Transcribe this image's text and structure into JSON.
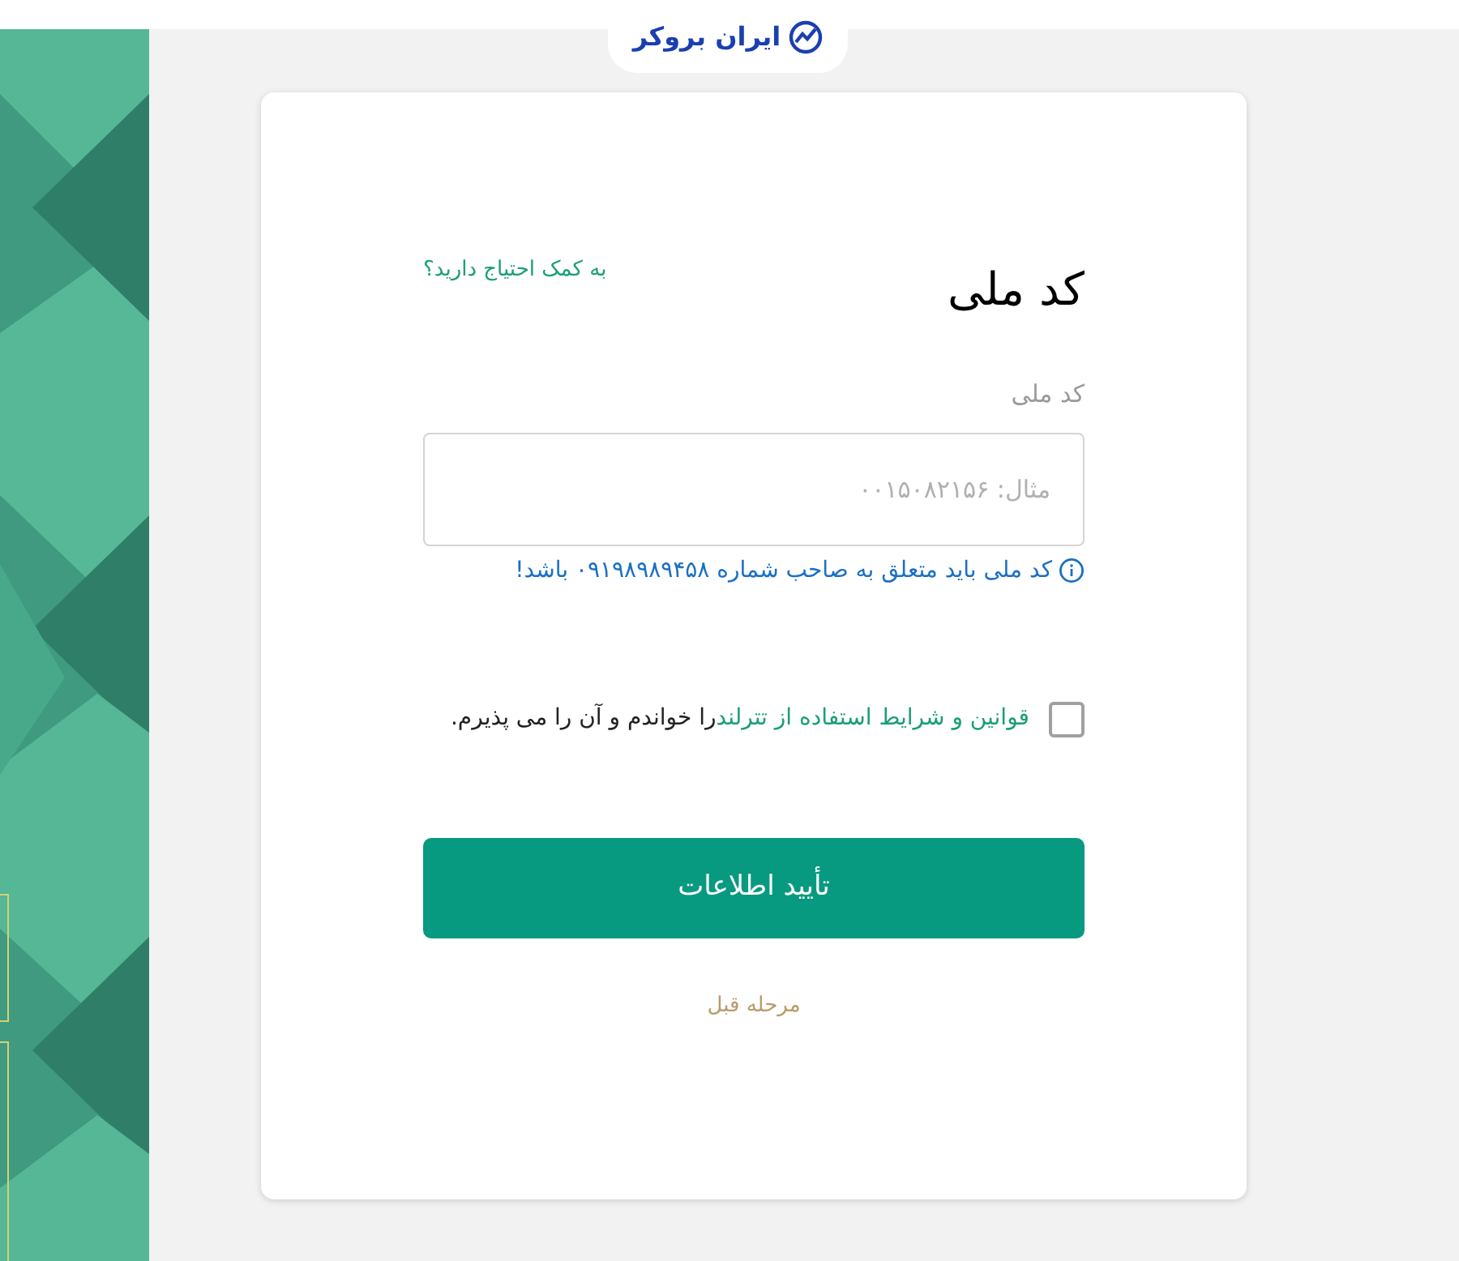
{
  "header": {
    "logo": "ایران بروکر"
  },
  "form": {
    "title": "کد ملی",
    "help_link": "به کمک احتیاج دارید؟",
    "field": {
      "label": "کد ملی",
      "placeholder": "مثال: ۰۰۱۵۰۸۲۱۵۶"
    },
    "hint": "کد ملی باید متعلق به صاحب شماره ۰۹۱۹۸۹۸۹۴۵۸ باشد!",
    "terms": {
      "checked": false,
      "link": "قوانین و شرایط استفاده از تترلند",
      "text": "را خواندم و آن را می پذیرم."
    },
    "submit": "تأیید اطلاعات",
    "back": "مرحله قبل"
  }
}
